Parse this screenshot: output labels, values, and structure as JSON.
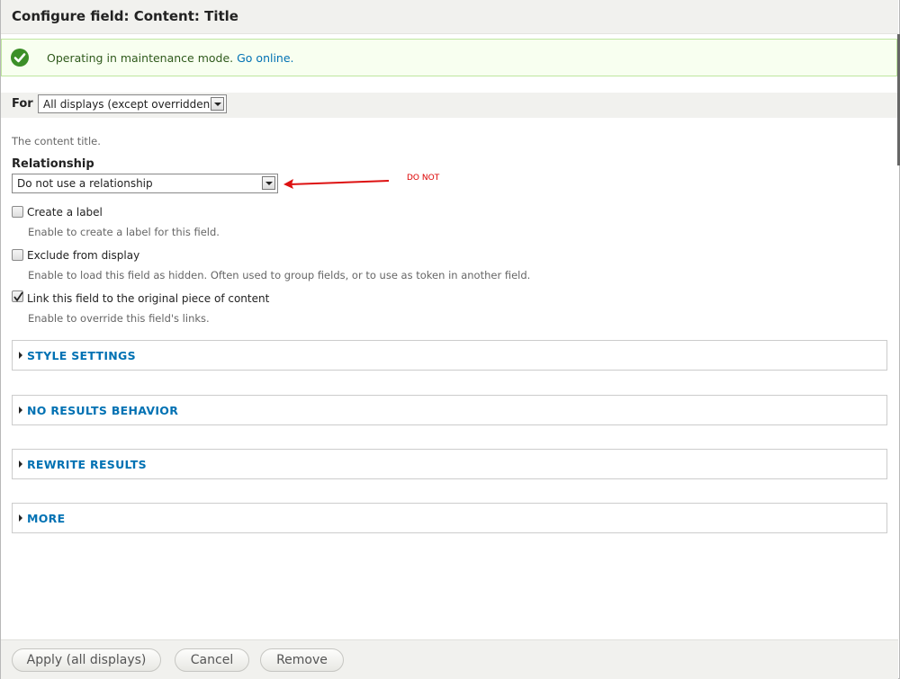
{
  "dialog": {
    "title": "Configure field: Content: Title"
  },
  "message": {
    "text": "Operating in maintenance mode.",
    "link": "Go online."
  },
  "for_bar": {
    "label": "For",
    "selected": "All displays (except overridden)"
  },
  "form": {
    "field_description": "The content title.",
    "relationship": {
      "label": "Relationship",
      "selected": "Do not use a relationship"
    },
    "annotation": "DO NOT",
    "options": [
      {
        "label": "Create a label",
        "checked": false,
        "description": "Enable to create a label for this field."
      },
      {
        "label": "Exclude from display",
        "checked": false,
        "description": "Enable to load this field as hidden. Often used to group fields, or to use as token in another field."
      },
      {
        "label": "Link this field to the original piece of content",
        "checked": true,
        "description": "Enable to override this field's links."
      }
    ],
    "sections": [
      {
        "label": "STYLE SETTINGS"
      },
      {
        "label": "NO RESULTS BEHAVIOR"
      },
      {
        "label": "REWRITE RESULTS"
      },
      {
        "label": "MORE"
      }
    ]
  },
  "footer": {
    "apply": "Apply (all displays)",
    "cancel": "Cancel",
    "remove": "Remove"
  },
  "colors": {
    "link": "#0071b3",
    "message_bg": "#f8fff0",
    "message_border": "#bee69f",
    "annotation": "#dd0000"
  }
}
